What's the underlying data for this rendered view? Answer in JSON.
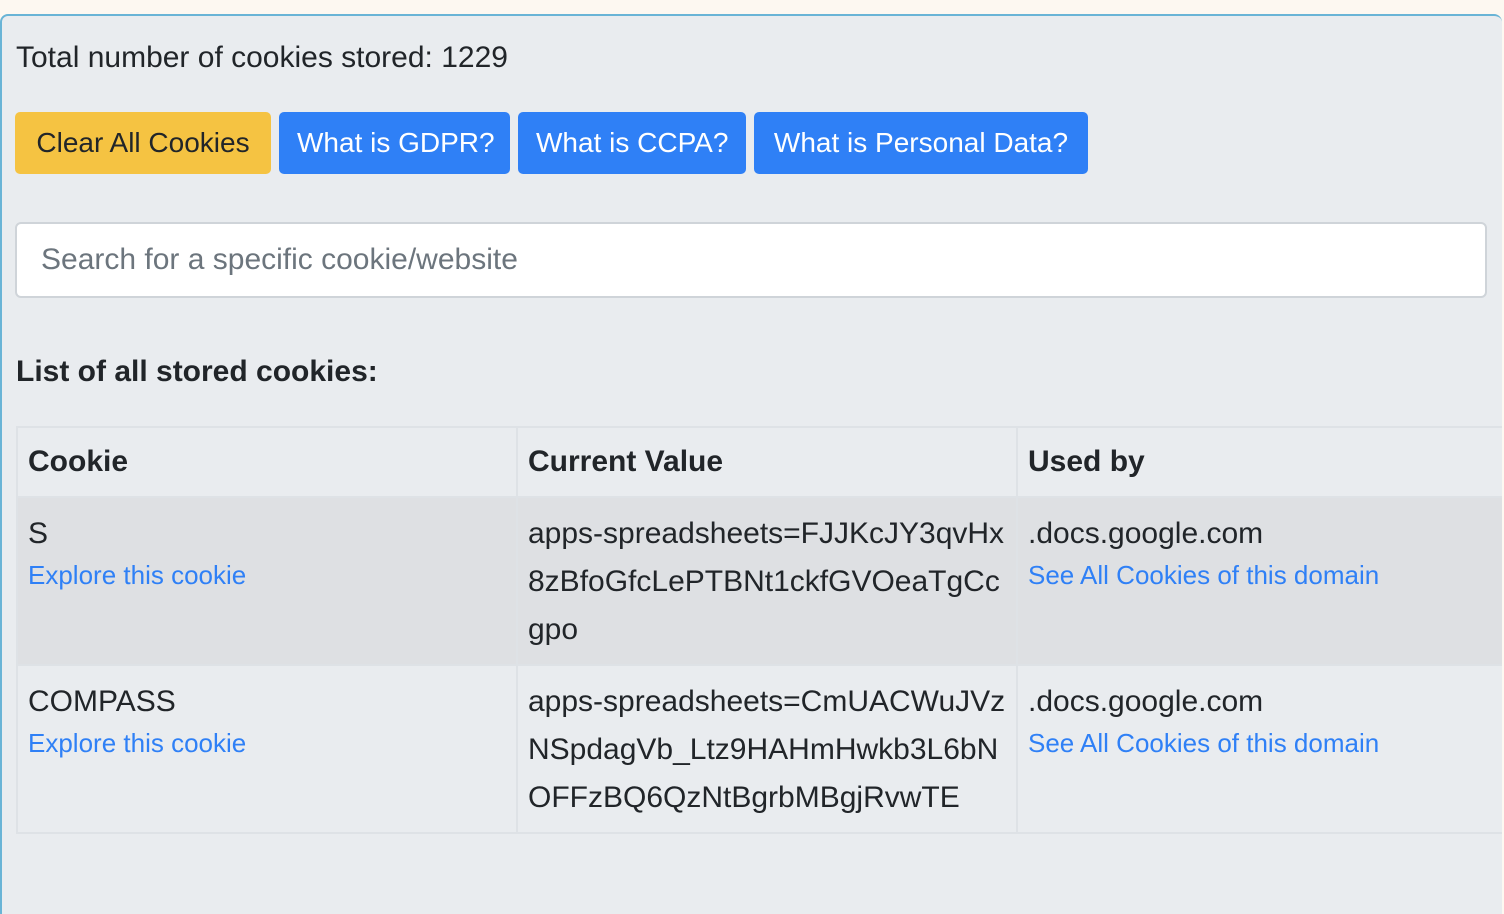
{
  "summary": {
    "total_text": "Total number of cookies stored: 1229"
  },
  "buttons": {
    "clear": "Clear All Cookies",
    "gdpr": "What is GDPR?",
    "ccpa": "What is CCPA?",
    "personal_data": "What is Personal Data?"
  },
  "search": {
    "placeholder": "Search for a specific cookie/website",
    "value": ""
  },
  "list": {
    "title": "List of all stored cookies:",
    "columns": [
      "Cookie",
      "Current Value",
      "Used by"
    ],
    "rows": [
      {
        "name": "S",
        "explore_label": "Explore this cookie",
        "value": "apps-spreadsheets=FJJKcJY3qvHx8zBfoGfcLePTBNt1ckfGVOeaTgCcgpo",
        "domain": ".docs.google.com",
        "domain_link": "See All Cookies of this domain"
      },
      {
        "name": "COMPASS",
        "explore_label": "Explore this cookie",
        "value": "apps-spreadsheets=CmUACWuJVzNSpdagVb_Ltz9HAHmHwkb3L6bNOFFzBQ6QzNtBgrbMBgjRvwTE",
        "domain": ".docs.google.com",
        "domain_link": "See All Cookies of this domain"
      }
    ]
  },
  "colors": {
    "primary": "#2f80f6",
    "warning": "#f5c342",
    "panel_bg": "#e9ecef",
    "panel_border": "#69b4d6"
  }
}
